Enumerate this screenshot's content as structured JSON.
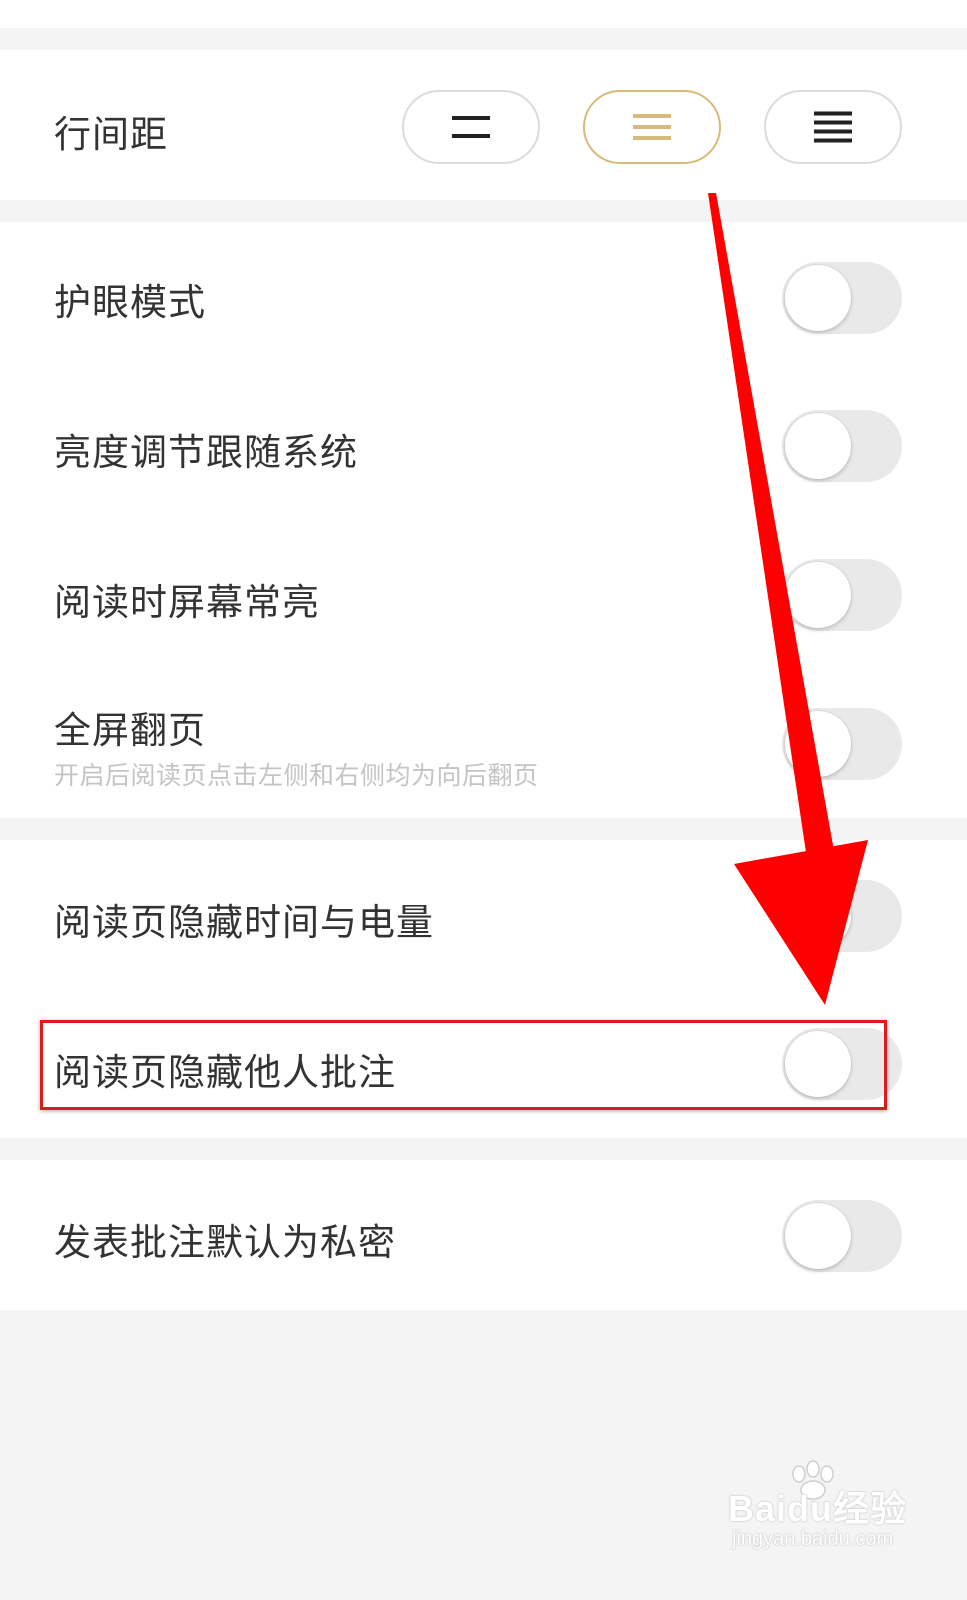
{
  "line_spacing": {
    "label": "行间距",
    "options": [
      {
        "name": "compact",
        "lines": 2,
        "selected": false
      },
      {
        "name": "medium",
        "lines": 3,
        "selected": true
      },
      {
        "name": "loose",
        "lines": 4,
        "selected": false
      }
    ]
  },
  "settings": {
    "eye_protection": {
      "label": "护眼模式",
      "on": false
    },
    "brightness_follow_system": {
      "label": "亮度调节跟随系统",
      "on": false
    },
    "screen_always_on": {
      "label": "阅读时屏幕常亮",
      "on": false
    },
    "fullscreen_page_turn": {
      "label": "全屏翻页",
      "description": "开启后阅读页点击左侧和右侧均为向后翻页",
      "on": false
    },
    "hide_time_battery": {
      "label": "阅读页隐藏时间与电量",
      "on": false
    },
    "hide_others_annotations": {
      "label": "阅读页隐藏他人批注",
      "on": false
    },
    "private_annotations": {
      "label": "发表批注默认为私密",
      "on": false
    }
  },
  "colors": {
    "accent": "#d9b97c",
    "annotation_red": "#e01919",
    "toggle_off": "#e9e9e9"
  },
  "watermark": {
    "brand": "Baidu经验",
    "url": "jingyan.baidu.com"
  }
}
